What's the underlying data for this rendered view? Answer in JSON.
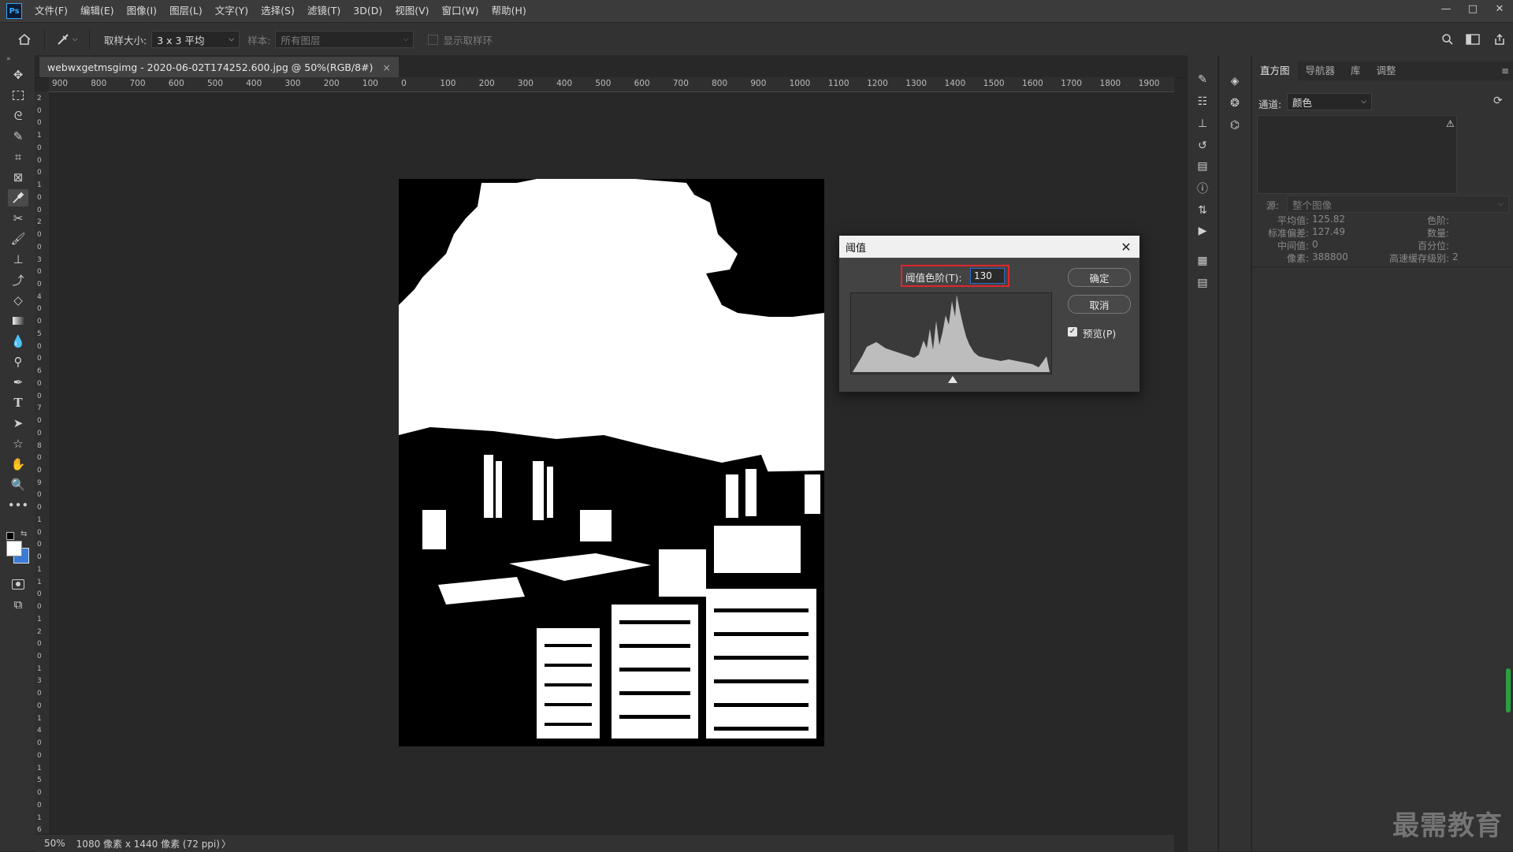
{
  "menubar": {
    "logo": "Ps",
    "items": [
      "文件(F)",
      "编辑(E)",
      "图像(I)",
      "图层(L)",
      "文字(Y)",
      "选择(S)",
      "滤镜(T)",
      "3D(D)",
      "视图(V)",
      "窗口(W)",
      "帮助(H)"
    ],
    "window_controls": [
      "—",
      "□",
      "✕"
    ]
  },
  "options": {
    "sample_size_label": "取样大小:",
    "sample_size_value": "3 x 3 平均",
    "sample_label": "样本:",
    "sample_value": "所有图层",
    "show_ring_label": "显示取样环"
  },
  "document": {
    "tab_title": "webwxgetmsgimg - 2020-06-02T174252.600.jpg @ 50%(RGB/8#)",
    "tab_close": "×"
  },
  "ruler": {
    "top_labels": [
      "900",
      "800",
      "700",
      "600",
      "500",
      "400",
      "300",
      "200",
      "100",
      "0",
      "100",
      "200",
      "300",
      "400",
      "500",
      "600",
      "700",
      "800",
      "900",
      "1000",
      "1100",
      "1200",
      "1300",
      "1400",
      "1500",
      "1600",
      "1700",
      "1800",
      "1900"
    ],
    "left_labels": [
      "2",
      "0",
      "0",
      "1",
      "0",
      "0",
      "0",
      "1",
      "0",
      "0",
      "2",
      "0",
      "0",
      "3",
      "0",
      "0",
      "4",
      "0",
      "0",
      "5",
      "0",
      "0",
      "6",
      "0",
      "0",
      "7",
      "0",
      "0",
      "8",
      "0",
      "0",
      "9",
      "0",
      "0",
      "1",
      "0",
      "0",
      "0",
      "1",
      "1",
      "0",
      "0",
      "1",
      "2",
      "0",
      "0",
      "1",
      "3",
      "0",
      "0",
      "1",
      "4",
      "0",
      "0",
      "1",
      "5",
      "0",
      "0",
      "1",
      "6"
    ]
  },
  "status": {
    "zoom": "50%",
    "doc_info": "1080 像素 x 1440 像素 (72 ppi)",
    "arrow": "〉"
  },
  "panel": {
    "tabs": [
      "直方图",
      "导航器",
      "库",
      "调整"
    ],
    "channel_label": "通道:",
    "channel_value": "颜色",
    "source_label": "源:",
    "source_value": "整个图像",
    "stats_left": [
      {
        "label": "平均值:",
        "value": "125.82"
      },
      {
        "label": "标准偏差:",
        "value": "127.49"
      },
      {
        "label": "中间值:",
        "value": "0"
      },
      {
        "label": "像素:",
        "value": "388800"
      }
    ],
    "stats_right": [
      {
        "label": "色阶:",
        "value": ""
      },
      {
        "label": "数量:",
        "value": ""
      },
      {
        "label": "百分位:",
        "value": ""
      },
      {
        "label": "高速缓存级别:",
        "value": "2"
      }
    ],
    "menu_icon": "≡"
  },
  "dialog": {
    "title": "阈值",
    "close": "✕",
    "level_label": "阈值色阶(T):",
    "level_value": "130",
    "ok_label": "确定",
    "cancel_label": "取消",
    "preview_label": "预览(P)",
    "preview_checked": true
  },
  "watermark": "最需教育",
  "colors": {
    "accent_red": "#e0262c",
    "focus_blue": "#2a6ccf"
  }
}
